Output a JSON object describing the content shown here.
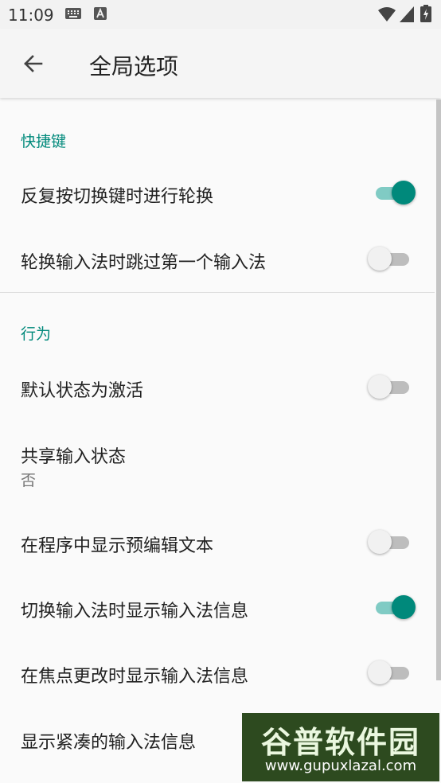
{
  "status_bar": {
    "time": "11:09",
    "icons": [
      "keyboard-icon",
      "a-icon",
      "wifi-icon",
      "signal-icon",
      "battery-icon"
    ]
  },
  "app_bar": {
    "title": "全局选项"
  },
  "sections": [
    {
      "header": "快捷键",
      "items": [
        {
          "title": "反复按切换键时进行轮换",
          "toggle": true
        },
        {
          "title": "轮换输入法时跳过第一个输入法",
          "toggle": false
        }
      ]
    },
    {
      "header": "行为",
      "items": [
        {
          "title": "默认状态为激活",
          "toggle": false
        },
        {
          "title": "共享输入状态",
          "summary": "否"
        },
        {
          "title": "在程序中显示预编辑文本",
          "toggle": false
        },
        {
          "title": "切换输入法时显示输入法信息",
          "toggle": true
        },
        {
          "title": "在焦点更改时显示输入法信息",
          "toggle": false
        },
        {
          "title": "显示紧凑的输入法信息"
        }
      ]
    }
  ],
  "watermark": {
    "name": "谷普软件园",
    "url": "www.gupuxlazal.com"
  },
  "colors": {
    "accent": "#00897b",
    "accent_track": "#80cbc4",
    "off_track": "#bdbdbd",
    "off_thumb": "#f1f1f1"
  }
}
